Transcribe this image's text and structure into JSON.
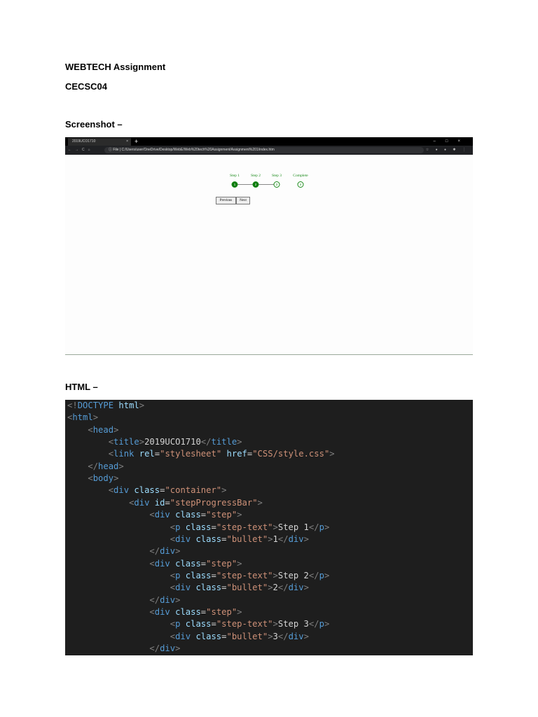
{
  "doc": {
    "title": "WEBTECH Assignment",
    "code": "CECSC04",
    "screenshot_heading": "Screenshot –",
    "html_heading": "HTML –"
  },
  "browser": {
    "tab_title": "2019UCO1710",
    "tab_close": "×",
    "new_tab": "+",
    "window_controls": "–□×",
    "nav": "←→C⌂",
    "url_prefix": "ⓘ File |",
    "url": "C:/Users/user/OneDrive/Desktop/WebE/Web%20tech%20Assignment/Assignment%201/index.htm",
    "extensions": "☆ ● ● ✱ ⋮"
  },
  "stepper": {
    "steps": [
      {
        "label": "Step 1",
        "bullet": "1",
        "done": true
      },
      {
        "label": "Step 2",
        "bullet": "2",
        "done": true
      },
      {
        "label": "Step 3",
        "bullet": "3",
        "done": false
      },
      {
        "label": "Complete",
        "bullet": "4",
        "done": false
      }
    ],
    "previous": "Previous",
    "next": "Next"
  },
  "code_lines": [
    [
      [
        "p",
        "<!"
      ],
      [
        "t",
        "DOCTYPE"
      ],
      [
        "x",
        " "
      ],
      [
        "kw",
        "html"
      ],
      [
        "p",
        ">"
      ]
    ],
    [
      [
        "p",
        "<"
      ],
      [
        "t",
        "html"
      ],
      [
        "p",
        ">"
      ]
    ],
    [
      [
        "x",
        "    "
      ],
      [
        "p",
        "<"
      ],
      [
        "t",
        "head"
      ],
      [
        "p",
        ">"
      ]
    ],
    [
      [
        "x",
        "        "
      ],
      [
        "p",
        "<"
      ],
      [
        "t",
        "title"
      ],
      [
        "p",
        ">"
      ],
      [
        "x",
        "2019UCO1710"
      ],
      [
        "p",
        "</"
      ],
      [
        "t",
        "title"
      ],
      [
        "p",
        ">"
      ]
    ],
    [
      [
        "x",
        "        "
      ],
      [
        "p",
        "<"
      ],
      [
        "t",
        "link"
      ],
      [
        "x",
        " "
      ],
      [
        "a",
        "rel"
      ],
      [
        "x",
        "="
      ],
      [
        "s",
        "\"stylesheet\""
      ],
      [
        "x",
        " "
      ],
      [
        "a",
        "href"
      ],
      [
        "x",
        "="
      ],
      [
        "s",
        "\"CSS/style.css\""
      ],
      [
        "p",
        ">"
      ]
    ],
    [
      [
        "x",
        "    "
      ],
      [
        "p",
        "</"
      ],
      [
        "t",
        "head"
      ],
      [
        "p",
        ">"
      ]
    ],
    [
      [
        "x",
        "    "
      ],
      [
        "p",
        "<"
      ],
      [
        "t",
        "body"
      ],
      [
        "p",
        ">"
      ]
    ],
    [
      [
        "x",
        "        "
      ],
      [
        "p",
        "<"
      ],
      [
        "t",
        "div"
      ],
      [
        "x",
        " "
      ],
      [
        "a",
        "class"
      ],
      [
        "x",
        "="
      ],
      [
        "s",
        "\"container\""
      ],
      [
        "p",
        ">"
      ]
    ],
    [
      [
        "x",
        "            "
      ],
      [
        "p",
        "<"
      ],
      [
        "t",
        "div"
      ],
      [
        "x",
        " "
      ],
      [
        "a",
        "id"
      ],
      [
        "x",
        "="
      ],
      [
        "s",
        "\"stepProgressBar\""
      ],
      [
        "p",
        ">"
      ]
    ],
    [
      [
        "x",
        "                "
      ],
      [
        "p",
        "<"
      ],
      [
        "t",
        "div"
      ],
      [
        "x",
        " "
      ],
      [
        "a",
        "class"
      ],
      [
        "x",
        "="
      ],
      [
        "s",
        "\"step\""
      ],
      [
        "p",
        ">"
      ]
    ],
    [
      [
        "x",
        "                    "
      ],
      [
        "p",
        "<"
      ],
      [
        "t",
        "p"
      ],
      [
        "x",
        " "
      ],
      [
        "a",
        "class"
      ],
      [
        "x",
        "="
      ],
      [
        "s",
        "\"step-text\""
      ],
      [
        "p",
        ">"
      ],
      [
        "x",
        "Step 1"
      ],
      [
        "p",
        "</"
      ],
      [
        "t",
        "p"
      ],
      [
        "p",
        ">"
      ]
    ],
    [
      [
        "x",
        "                    "
      ],
      [
        "p",
        "<"
      ],
      [
        "t",
        "div"
      ],
      [
        "x",
        " "
      ],
      [
        "a",
        "class"
      ],
      [
        "x",
        "="
      ],
      [
        "s",
        "\"bullet\""
      ],
      [
        "p",
        ">"
      ],
      [
        "x",
        "1"
      ],
      [
        "p",
        "</"
      ],
      [
        "t",
        "div"
      ],
      [
        "p",
        ">"
      ]
    ],
    [
      [
        "x",
        "                "
      ],
      [
        "p",
        "</"
      ],
      [
        "t",
        "div"
      ],
      [
        "p",
        ">"
      ]
    ],
    [
      [
        "x",
        "                "
      ],
      [
        "p",
        "<"
      ],
      [
        "t",
        "div"
      ],
      [
        "x",
        " "
      ],
      [
        "a",
        "class"
      ],
      [
        "x",
        "="
      ],
      [
        "s",
        "\"step\""
      ],
      [
        "p",
        ">"
      ]
    ],
    [
      [
        "x",
        "                    "
      ],
      [
        "p",
        "<"
      ],
      [
        "t",
        "p"
      ],
      [
        "x",
        " "
      ],
      [
        "a",
        "class"
      ],
      [
        "x",
        "="
      ],
      [
        "s",
        "\"step-text\""
      ],
      [
        "p",
        ">"
      ],
      [
        "x",
        "Step 2"
      ],
      [
        "p",
        "</"
      ],
      [
        "t",
        "p"
      ],
      [
        "p",
        ">"
      ]
    ],
    [
      [
        "x",
        "                    "
      ],
      [
        "p",
        "<"
      ],
      [
        "t",
        "div"
      ],
      [
        "x",
        " "
      ],
      [
        "a",
        "class"
      ],
      [
        "x",
        "="
      ],
      [
        "s",
        "\"bullet\""
      ],
      [
        "p",
        ">"
      ],
      [
        "x",
        "2"
      ],
      [
        "p",
        "</"
      ],
      [
        "t",
        "div"
      ],
      [
        "p",
        ">"
      ]
    ],
    [
      [
        "x",
        "                "
      ],
      [
        "p",
        "</"
      ],
      [
        "t",
        "div"
      ],
      [
        "p",
        ">"
      ]
    ],
    [
      [
        "x",
        "                "
      ],
      [
        "p",
        "<"
      ],
      [
        "t",
        "div"
      ],
      [
        "x",
        " "
      ],
      [
        "a",
        "class"
      ],
      [
        "x",
        "="
      ],
      [
        "s",
        "\"step\""
      ],
      [
        "p",
        ">"
      ]
    ],
    [
      [
        "x",
        "                    "
      ],
      [
        "p",
        "<"
      ],
      [
        "t",
        "p"
      ],
      [
        "x",
        " "
      ],
      [
        "a",
        "class"
      ],
      [
        "x",
        "="
      ],
      [
        "s",
        "\"step-text\""
      ],
      [
        "p",
        ">"
      ],
      [
        "x",
        "Step 3"
      ],
      [
        "p",
        "</"
      ],
      [
        "t",
        "p"
      ],
      [
        "p",
        ">"
      ]
    ],
    [
      [
        "x",
        "                    "
      ],
      [
        "p",
        "<"
      ],
      [
        "t",
        "div"
      ],
      [
        "x",
        " "
      ],
      [
        "a",
        "class"
      ],
      [
        "x",
        "="
      ],
      [
        "s",
        "\"bullet\""
      ],
      [
        "p",
        ">"
      ],
      [
        "x",
        "3"
      ],
      [
        "p",
        "</"
      ],
      [
        "t",
        "div"
      ],
      [
        "p",
        ">"
      ]
    ],
    [
      [
        "x",
        "                "
      ],
      [
        "p",
        "</"
      ],
      [
        "t",
        "div"
      ],
      [
        "p",
        ">"
      ]
    ]
  ]
}
